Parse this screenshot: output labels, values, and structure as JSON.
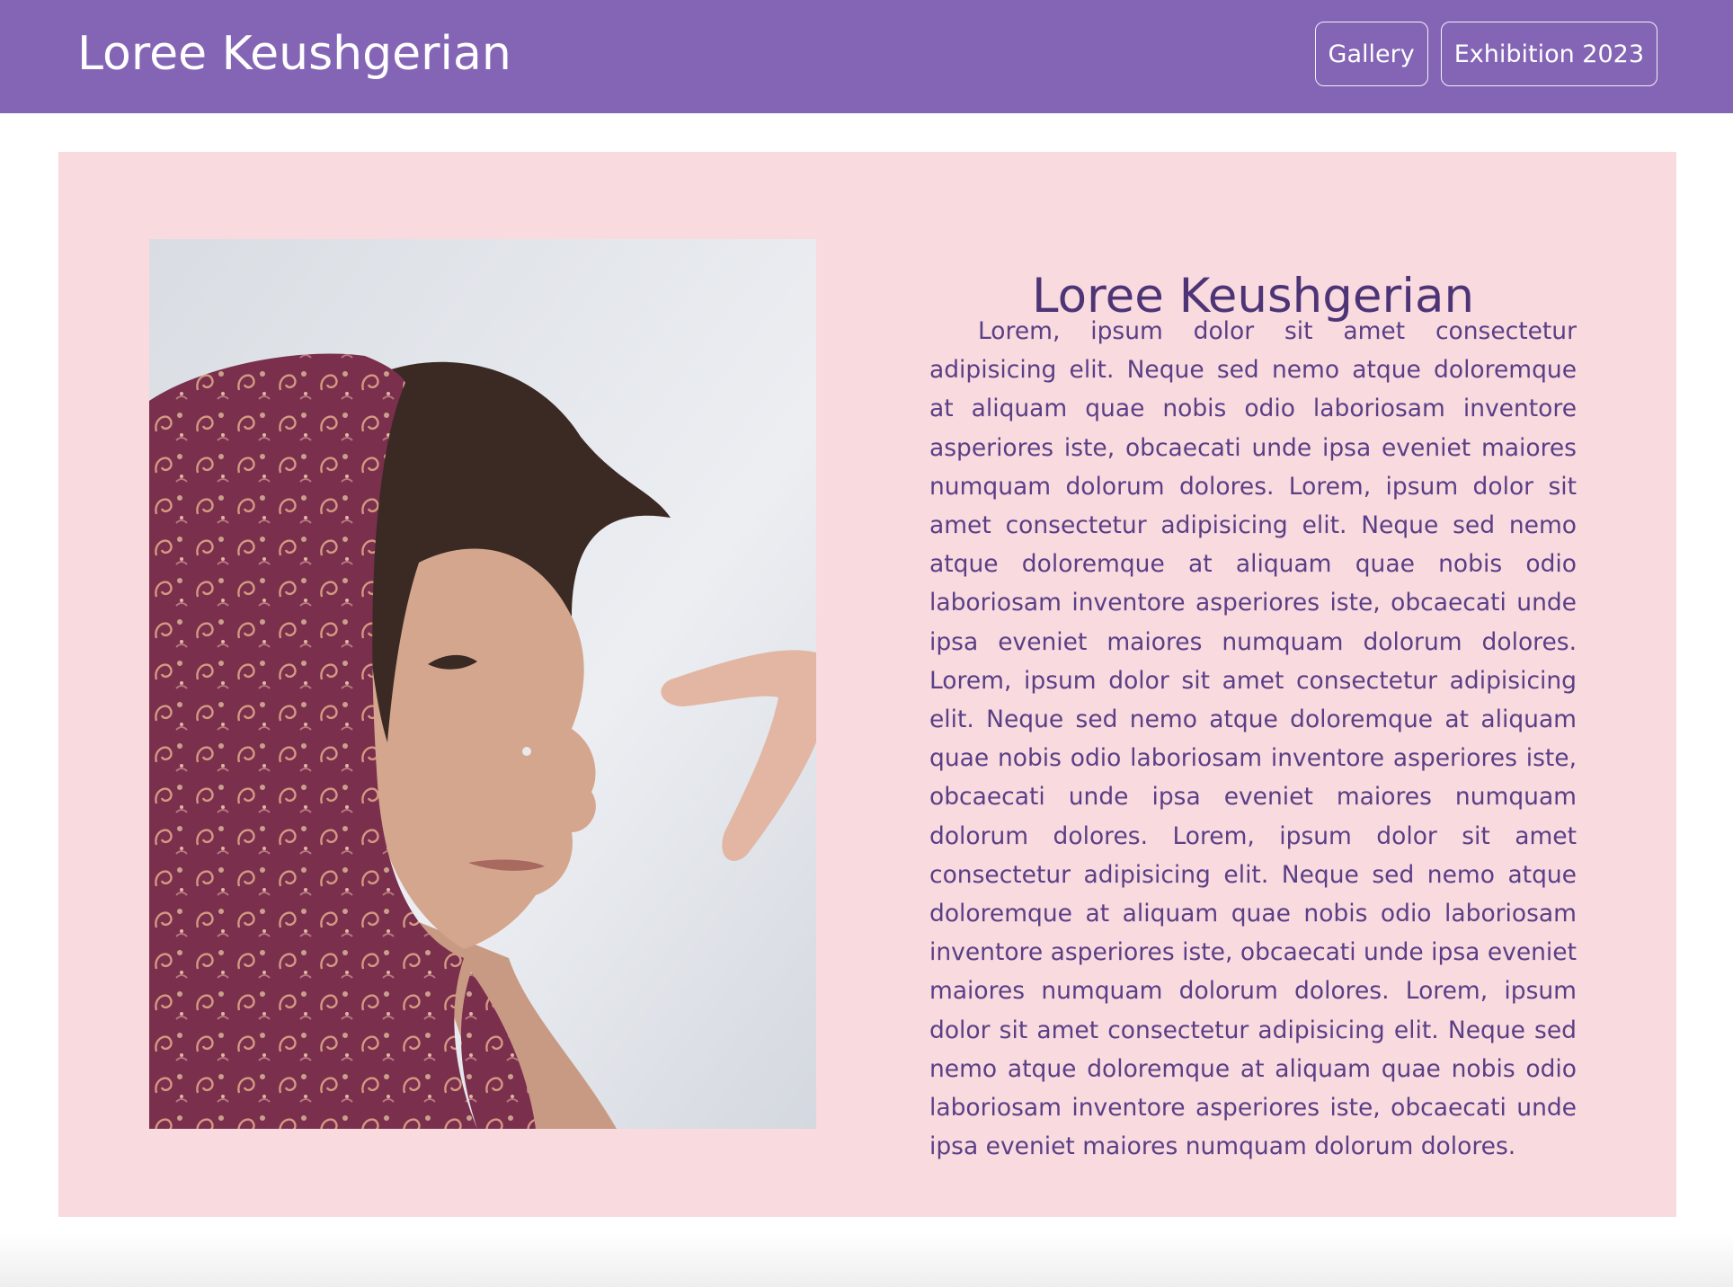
{
  "header": {
    "brand": "Loree Keushgerian",
    "nav": [
      {
        "label": "Gallery"
      },
      {
        "label": "Exhibition 2023"
      }
    ],
    "background_color": "#8465b5"
  },
  "main": {
    "background_color": "#f9dadf",
    "title": "Loree Keushgerian",
    "paragraph": "Lorem, ipsum dolor sit amet consectetur adipisicing elit. Neque sed nemo atque doloremque at aliquam quae nobis odio laboriosam inventore asperiores iste, obcaecati unde ipsa eveniet maiores numquam dolorum dolores. Lorem, ipsum dolor sit amet consectetur adipisicing elit. Neque sed nemo atque doloremque at aliquam quae nobis odio laboriosam inventore asperiores iste, obcaecati unde ipsa eveniet maiores numquam dolorum dolores. Lorem, ipsum dolor sit amet consectetur adipisicing elit. Neque sed nemo atque doloremque at aliquam quae nobis odio laboriosam inventore asperiores iste, obcaecati unde ipsa eveniet maiores numquam dolorum dolores. Lorem, ipsum dolor sit amet consectetur adipisicing elit. Neque sed nemo atque doloremque at aliquam quae nobis odio laboriosam inventore asperiores iste, obcaecati unde ipsa eveniet maiores numquam dolorum dolores. Lorem, ipsum dolor sit amet consectetur adipisicing elit. Neque sed nemo atque doloremque at aliquam quae nobis odio laboriosam inventore asperiores iste, obcaecati unde ipsa eveniet maiores numquam dolorum dolores."
  }
}
